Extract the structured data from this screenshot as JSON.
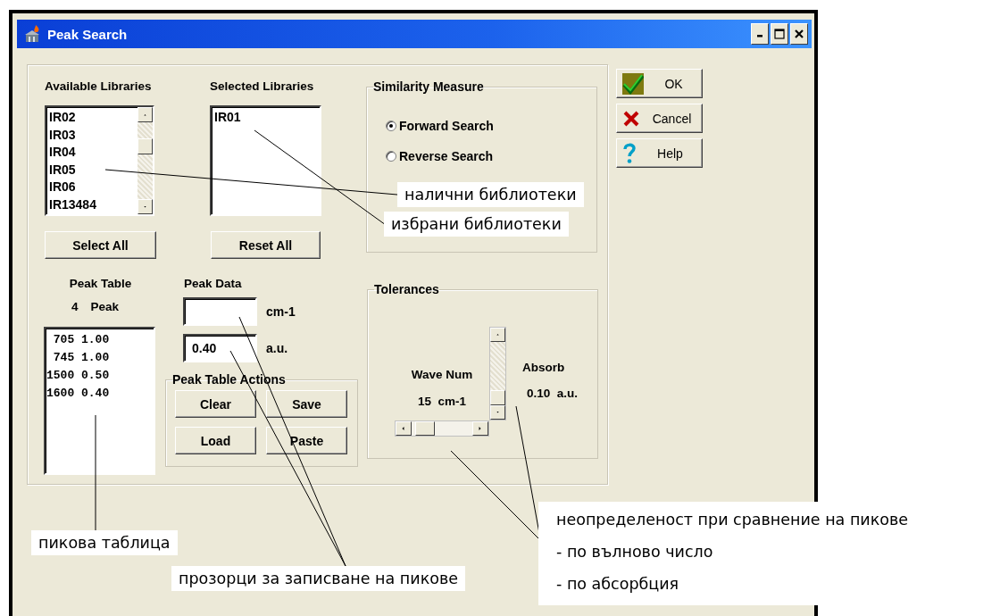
{
  "window": {
    "title": "Peak Search"
  },
  "available_libraries": {
    "label": "Available Libraries",
    "items": [
      "IR02",
      "IR03",
      "IR04",
      "IR05",
      "IR06",
      "IR13484"
    ],
    "button": {
      "label": "Select All"
    }
  },
  "selected_libraries": {
    "label": "Selected Libraries",
    "items": [
      "IR01"
    ],
    "button": {
      "label": "Reset All"
    }
  },
  "similarity_measure": {
    "label": "Similarity Measure",
    "options": [
      {
        "label": "Forward Search",
        "selected": true
      },
      {
        "label": "Reverse Search",
        "selected": false
      }
    ]
  },
  "peak_table": {
    "label": "Peak Table",
    "count": "4",
    "unit": "Peak",
    "rows": [
      " 705 1.00",
      " 745 1.00",
      "1500 0.50",
      "1600 0.40"
    ]
  },
  "peak_data": {
    "label": "Peak Data",
    "fields": [
      {
        "unit": "cm-1"
      },
      {
        "value": "0.40",
        "unit": "a.u."
      }
    ]
  },
  "peak_table_actions": {
    "label": "Peak Table Actions",
    "buttons": [
      {
        "label": "Clear"
      },
      {
        "label": "Save"
      },
      {
        "label": "Load"
      },
      {
        "label": "Paste"
      }
    ]
  },
  "tolerances": {
    "label": "Tolerances",
    "wave_num_label": "Wave Num",
    "wave_num_value": "15  cm-1",
    "absorb_label": "Absorb",
    "absorb_value": "0.10  a.u."
  },
  "dialog_buttons": [
    {
      "kind": "ok",
      "label": "OK"
    },
    {
      "kind": "cancel",
      "label": "Cancel"
    },
    {
      "kind": "help",
      "label": "Help"
    }
  ],
  "annotations": [
    {
      "lines": [
        "налични библиотеки"
      ]
    },
    {
      "lines": [
        "избрани библиотеки"
      ]
    },
    {
      "lines": [
        "пикова таблица"
      ]
    },
    {
      "lines": [
        "прозорци за записване на пикове"
      ]
    },
    {
      "lines": [
        "неопределеност при сравнение на пикове",
        "- по вълново число",
        "- по абсорбция"
      ]
    }
  ]
}
